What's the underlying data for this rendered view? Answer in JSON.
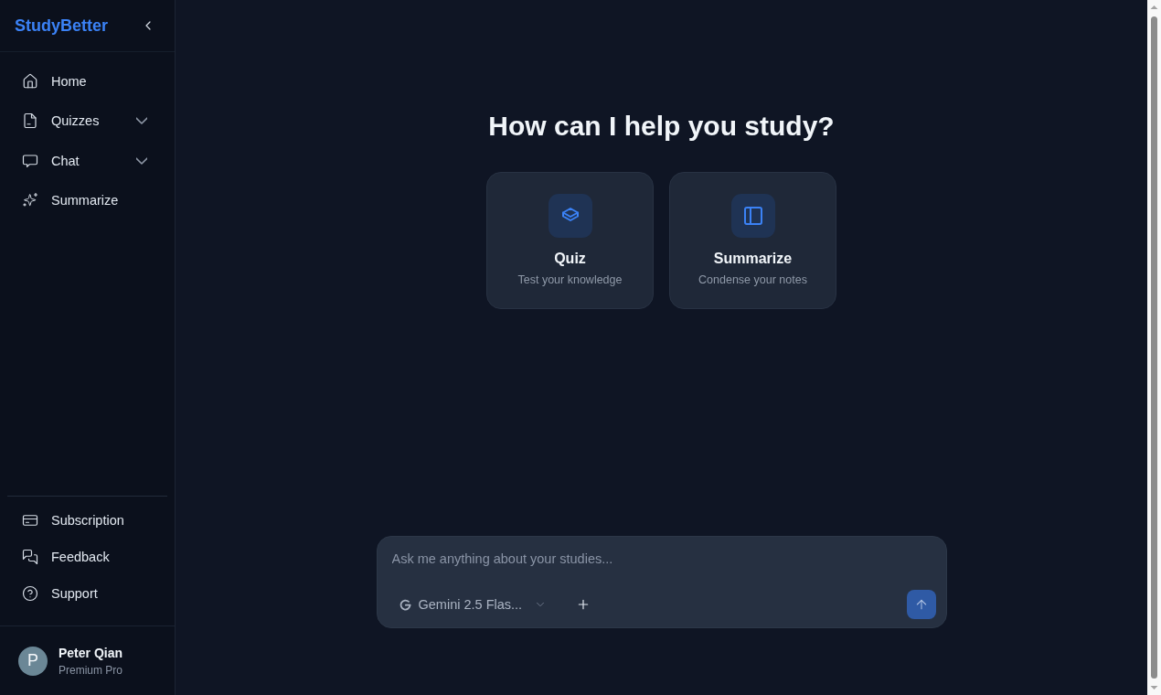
{
  "sidebar": {
    "logo": "StudyBetter",
    "nav": [
      {
        "label": "Home"
      },
      {
        "label": "Quizzes",
        "expanded": false
      },
      {
        "label": "Chat",
        "expanded": false
      },
      {
        "label": "Summarize"
      }
    ],
    "footer_nav": [
      {
        "label": "Subscription"
      },
      {
        "label": "Feedback"
      },
      {
        "label": "Support"
      }
    ],
    "user": {
      "initial": "P",
      "name": "Peter Qian",
      "plan": "Premium Pro"
    }
  },
  "main": {
    "heading": "How can I help you study?",
    "cards": [
      {
        "title": "Quiz",
        "subtitle": "Test your knowledge"
      },
      {
        "title": "Summarize",
        "subtitle": "Condense your notes"
      }
    ],
    "composer": {
      "placeholder": "Ask me anything about your studies...",
      "model": "Gemini 2.5 Flas..."
    }
  }
}
